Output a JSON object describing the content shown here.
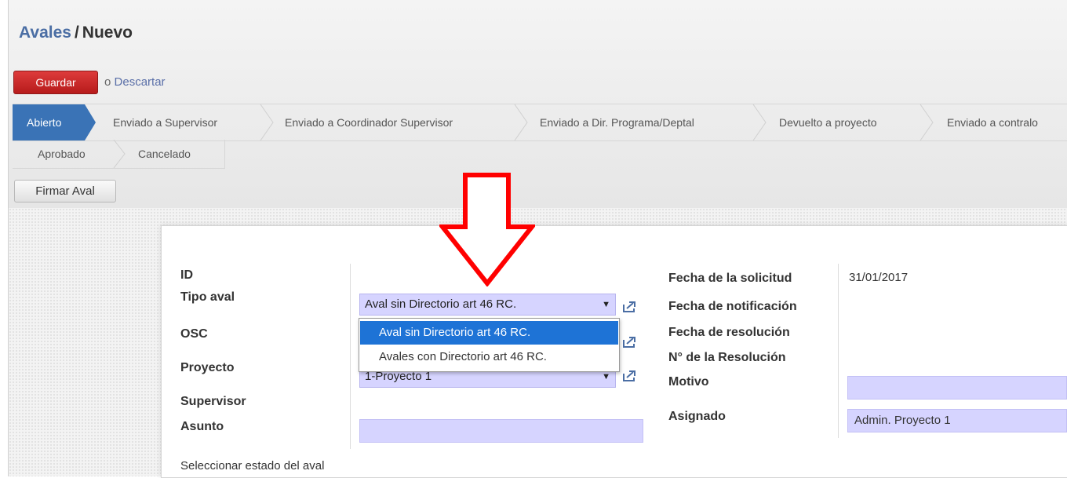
{
  "breadcrumb": {
    "parent": "Avales",
    "separator": "/",
    "current": "Nuevo"
  },
  "actions": {
    "save_label": "Guardar",
    "or_text": "o",
    "discard_label": "Descartar"
  },
  "statusbar": {
    "row1": [
      "Abierto",
      "Enviado a Supervisor",
      "Enviado a Coordinador Supervisor",
      "Enviado a Dir. Programa/Deptal",
      "Devuelto a proyecto",
      "Enviado a contralo"
    ],
    "row2": [
      "Aprobado",
      "Cancelado"
    ]
  },
  "sign_button": "Firmar Aval",
  "form": {
    "left_labels": {
      "id": "ID",
      "tipo": "Tipo aval",
      "osc": "OSC",
      "proyecto": "Proyecto",
      "supervisor": "Supervisor",
      "asunto": "Asunto"
    },
    "tipo_value": "Aval sin Directorio art 46 RC.",
    "proyecto_value": "1-Proyecto 1",
    "right_labels": {
      "fecha_solicitud": "Fecha de la solicitud",
      "fecha_notificacion": "Fecha de notificación",
      "fecha_resolucion": "Fecha de resolución",
      "num_resolucion": "N° de la Resolución",
      "motivo": "Motivo",
      "asignado": "Asignado"
    },
    "fecha_solicitud_value": "31/01/2017",
    "asignado_value": "Admin. Proyecto 1",
    "footer_text": "Seleccionar estado del aval"
  },
  "dropdown": {
    "options": [
      "Aval sin Directorio art 46 RC.",
      "Avales con Directorio art 46 RC."
    ],
    "selected_index": 0
  },
  "colors": {
    "save_button": "#c62828",
    "active_stage": "#3a73b6",
    "field_bg": "#d6d4ff",
    "arrow": "#ff0000",
    "selected_option": "#1e73d6"
  }
}
